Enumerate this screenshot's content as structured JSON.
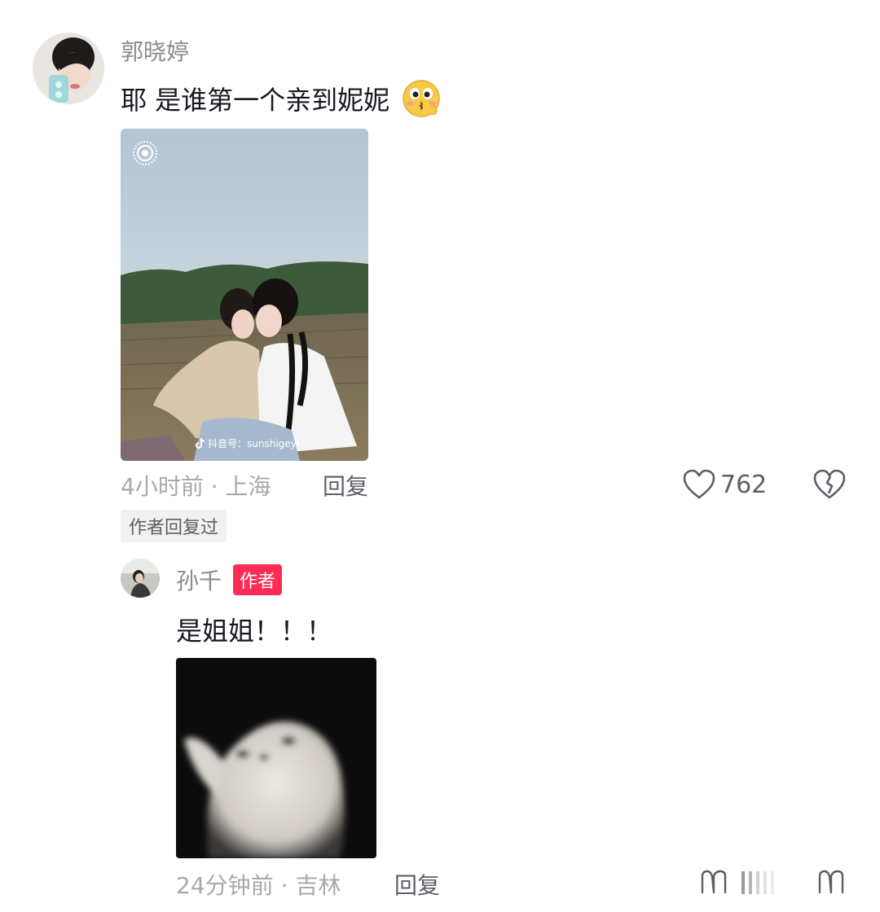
{
  "comment": {
    "username": "郭晓婷",
    "text": "耶 是谁第一个亲到妮妮",
    "emoji_icon": "kissing-face-emoji-icon",
    "image": {
      "icon": "live-photo-icon",
      "watermark_icon": "tiktok-logo-icon",
      "watermark": "抖音号：sunshigeyi"
    },
    "time_location": "4小时前 · 上海",
    "reply_label": "回复",
    "like_count": "762",
    "author_replied_tag": "作者回复过"
  },
  "reply": {
    "username": "孙千",
    "author_badge": "作者",
    "text": "是姐姐！！！",
    "time_location": "24分钟前 · 吉林",
    "reply_label": "回复"
  },
  "colors": {
    "accent": "#fe2c55",
    "muted_text": "#a8a9ad",
    "primary_text": "#161823"
  }
}
